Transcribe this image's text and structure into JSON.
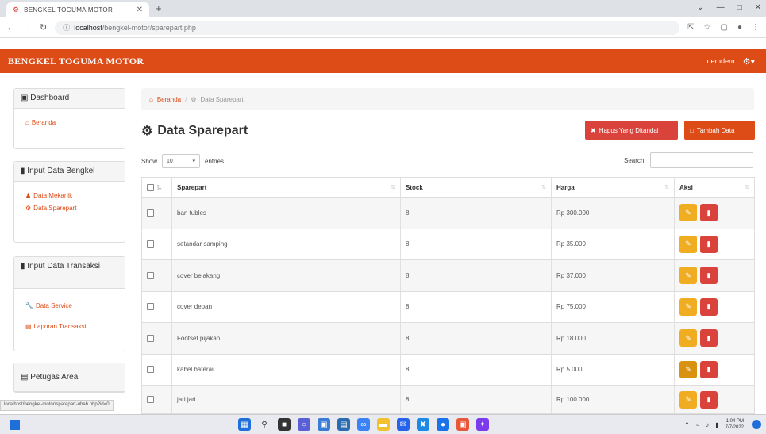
{
  "browser": {
    "tab_title": "BENGKEL TOGUMA MOTOR",
    "url_host": "localhost",
    "url_path": "/bengkel-motor/sparepart.php"
  },
  "app": {
    "brand": "BENGKEL TOGUMA MOTOR",
    "user": "demdem"
  },
  "sidebar": {
    "dashboard_title": "Dashboard",
    "beranda": "Beranda",
    "input_bengkel_title": "Input Data Bengkel",
    "data_mekanik": "Data Mekanik",
    "data_sparepart": "Data Sparepart",
    "input_transaksi_title": "Input Data Transaksi",
    "data_service": "Data Service",
    "laporan_transaksi": "Laporan Transaksi",
    "petugas_area": "Petugas Area"
  },
  "breadcrumb": {
    "home": "Beranda",
    "current": "Data Sparepart"
  },
  "page": {
    "title": "Data Sparepart",
    "btn_delete_selected": "Hapus Yang Ditandai",
    "btn_add": "Tambah Data",
    "show_label": "Show",
    "entries_value": "10",
    "entries_label": "entries",
    "search_label": "Search:"
  },
  "table": {
    "columns": [
      "Sparepart",
      "Stock",
      "Harga",
      "Aksi"
    ],
    "rows": [
      {
        "sparepart": "ban tubles",
        "stock": "8",
        "harga": "Rp 300.000"
      },
      {
        "sparepart": "setandar samping",
        "stock": "8",
        "harga": "Rp 35.000"
      },
      {
        "sparepart": "cover belakang",
        "stock": "8",
        "harga": "Rp 37.000"
      },
      {
        "sparepart": "cover depan",
        "stock": "8",
        "harga": "Rp 75.000"
      },
      {
        "sparepart": "Footset pijakan",
        "stock": "8",
        "harga": "Rp 18.000"
      },
      {
        "sparepart": "kabel baterai",
        "stock": "8",
        "harga": "Rp 5.000"
      },
      {
        "sparepart": "jari jari",
        "stock": "8",
        "harga": "Rp 100.000"
      }
    ]
  },
  "statusbar": {
    "text": "localhost/bengkel-motor/sparepart-ubah.php?id=0"
  },
  "taskbar": {
    "time": "1:04 PM",
    "date": "7/7/2022"
  },
  "colors": {
    "brand": "#dd4b16",
    "danger": "#d9433b",
    "warning": "#f0ad22"
  }
}
